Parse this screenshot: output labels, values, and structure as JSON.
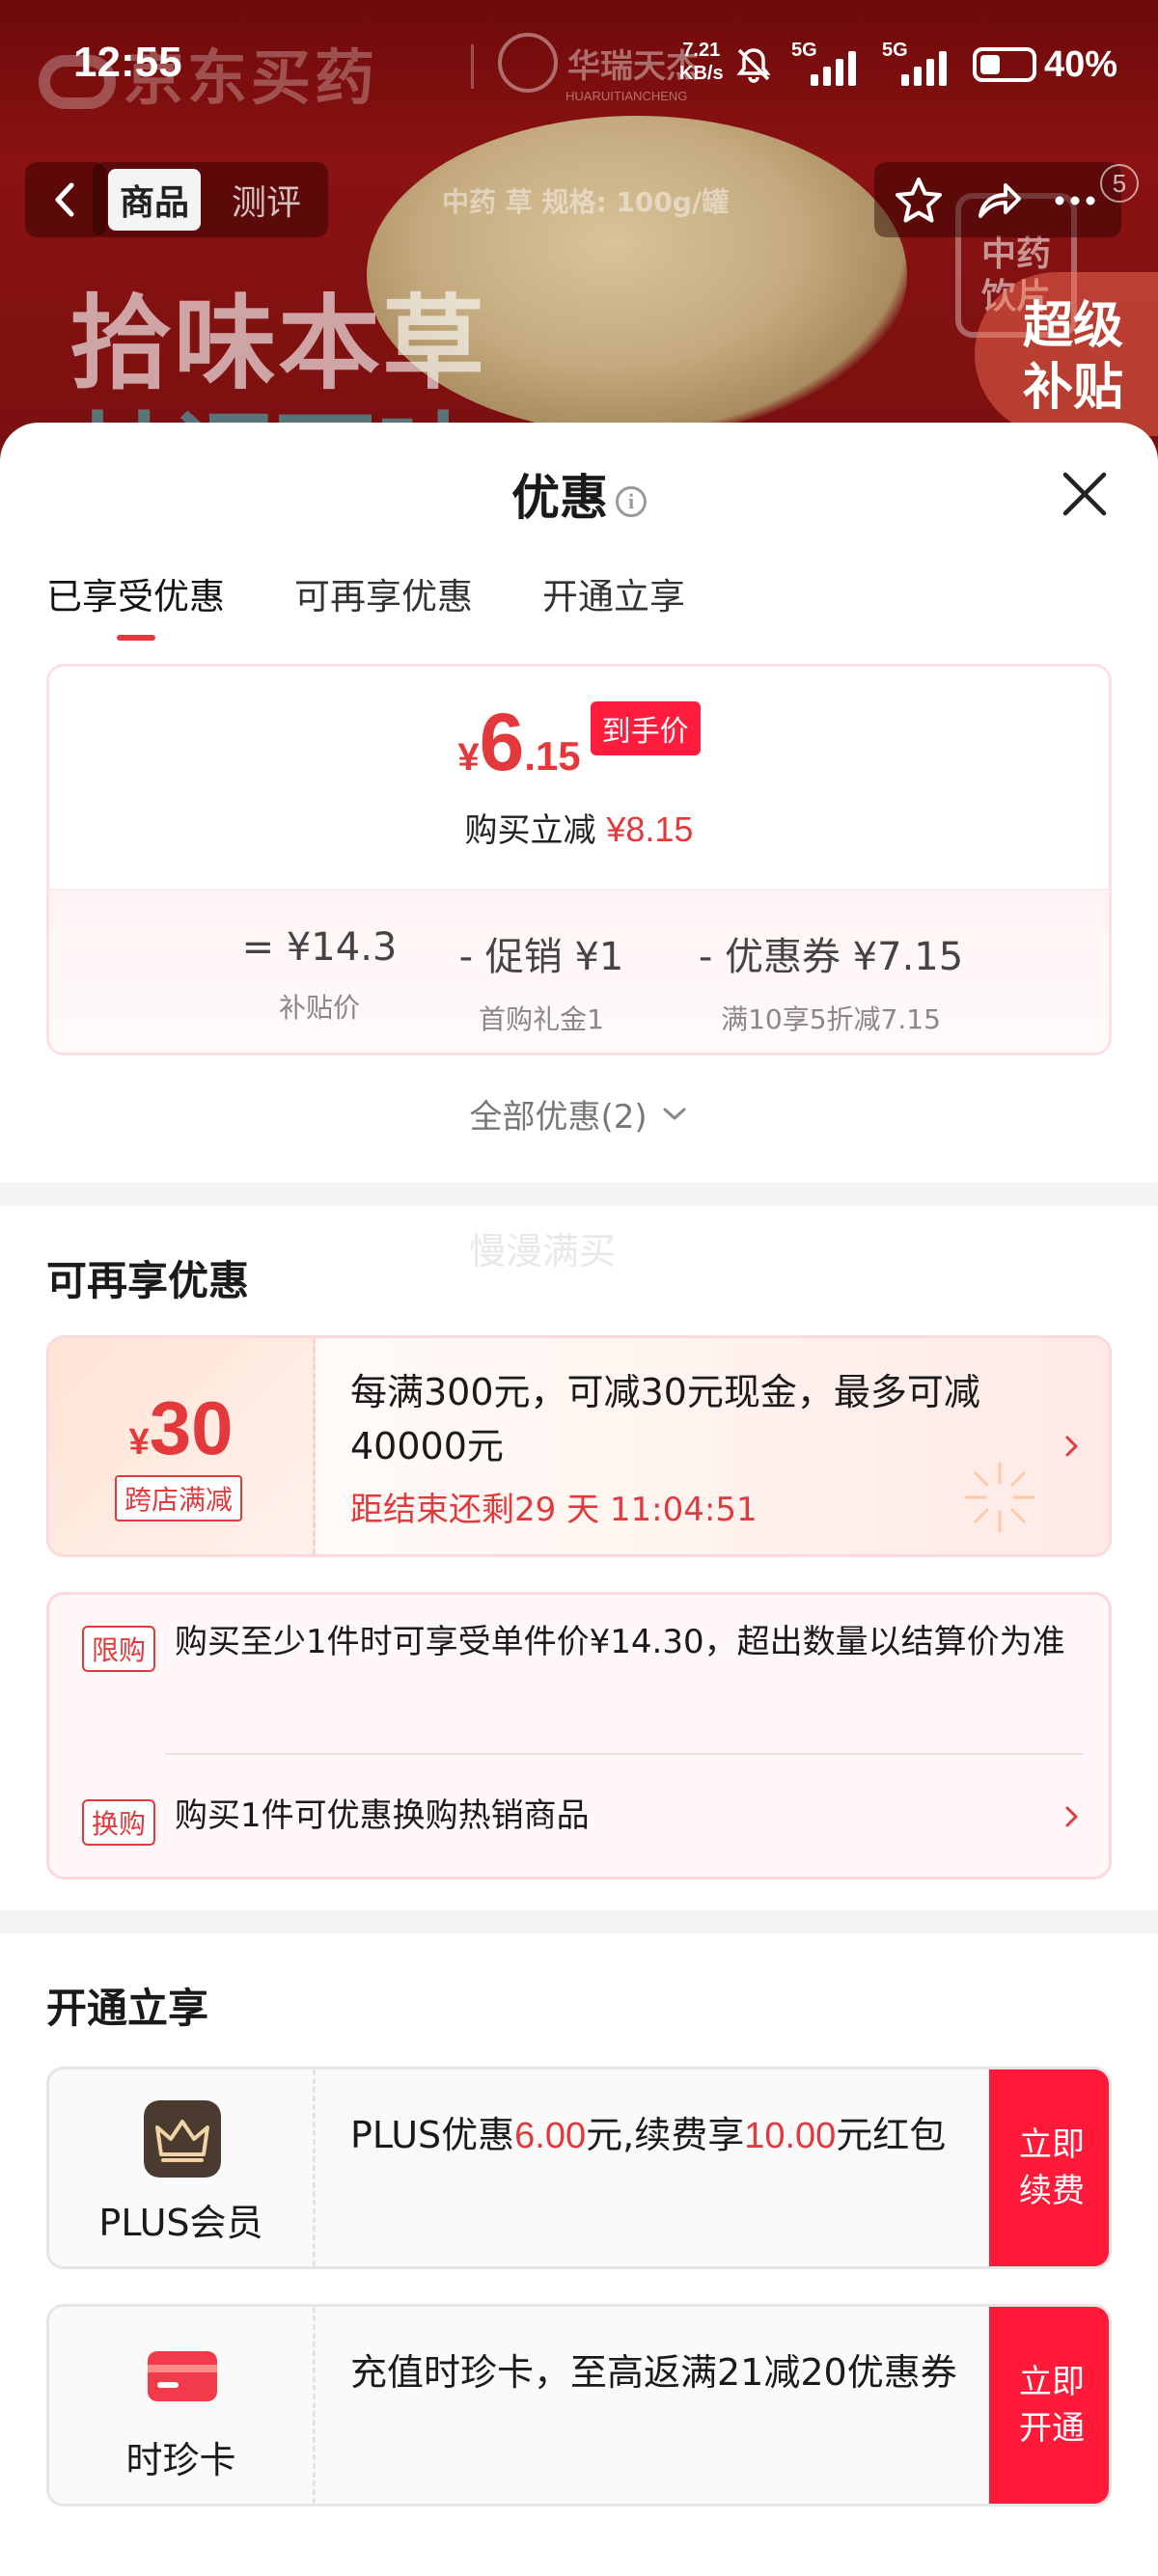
{
  "status_bar": {
    "time": "12:55",
    "net_speed": "7.21",
    "net_unit": "KB/s",
    "sig1": "5G",
    "sig2": "5G",
    "battery": "40%"
  },
  "background": {
    "brand": "京东买药",
    "partner": "华瑞天杰",
    "partner_pinyin": "HUARUITIANCHENG",
    "nav_tabs": [
      "商品",
      "测评"
    ],
    "spec": "中药 草 规格: 100g/罐",
    "badge_count": "5",
    "product_title_1": "拾味本草",
    "product_title_2": "甘调百味",
    "product_badge": "中药 饮片",
    "subsidy_label": "超级 补贴"
  },
  "sheet": {
    "title": "优惠",
    "tabs": [
      "已享受优惠",
      "可再享优惠",
      "开通立享"
    ],
    "price": {
      "currency": "¥",
      "int": "6",
      "dec": ".15",
      "tag": "到手价",
      "instant_label": "购买立减",
      "instant_amount": "¥8.15"
    },
    "calc": [
      {
        "main": "= ¥14.3",
        "sub": "补贴价"
      },
      {
        "main": "- 促销 ¥1",
        "sub": "首购礼金1"
      },
      {
        "main": "- 优惠券 ¥7.15",
        "sub": "满10享5折减7.15"
      }
    ],
    "all_promo": "全部优惠(2)",
    "ghost": "慢漫满买"
  },
  "more": {
    "title": "可再享优惠",
    "coupon": {
      "currency": "¥",
      "amount": "30",
      "type": "跨店满减",
      "desc": "每满300元，可减30元现金，最多可减40000元",
      "timer": "距结束还剩29 天 11:04:51"
    },
    "rules": [
      {
        "tag": "限购",
        "text": "购买至少1件时可享受单件价¥14.30，超出数量以结算价为准"
      },
      {
        "tag": "换购",
        "text": "购买1件可优惠换购热销商品"
      }
    ]
  },
  "open": {
    "title": "开通立享",
    "offers": [
      {
        "name": "PLUS会员",
        "desc_a": "PLUS优惠",
        "amt1": "6.00",
        "desc_b": "元,续费享",
        "amt2": "10.00",
        "desc_c": "元红包",
        "button": "立即 续费"
      },
      {
        "name": "时珍卡",
        "desc": "充值时珍卡，至高返满21减20优惠券",
        "button": "立即 开通"
      }
    ]
  },
  "colors": {
    "accent": "#e4393c",
    "button": "#ff1a3a",
    "header_bg": "#7a1010"
  }
}
